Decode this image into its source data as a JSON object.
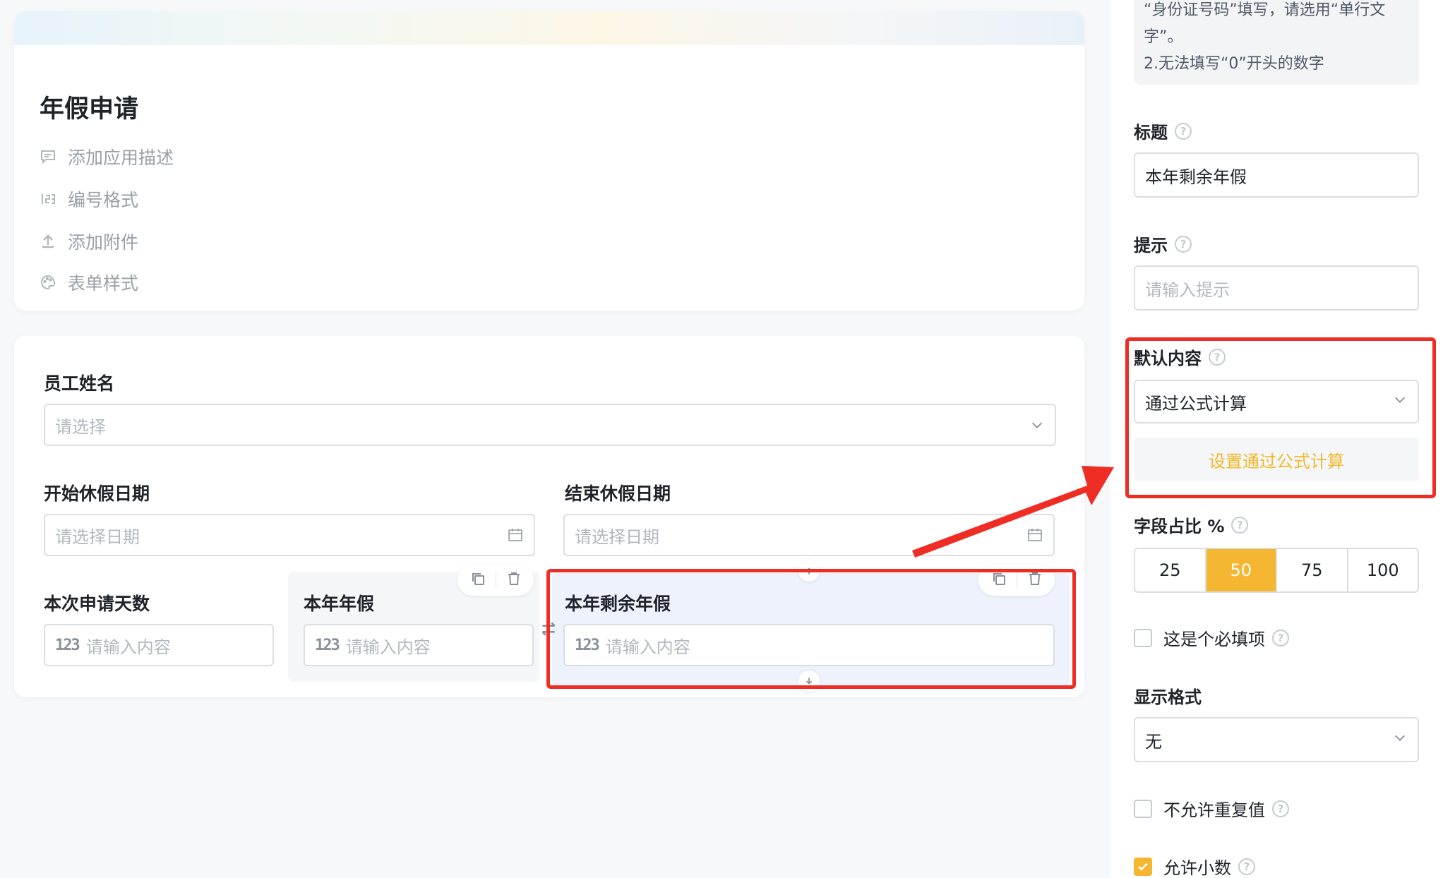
{
  "form": {
    "title": "年假申请",
    "options": [
      {
        "icon": "comment-icon",
        "label": "添加应用描述"
      },
      {
        "icon": "number-format-icon",
        "label": "编号格式"
      },
      {
        "icon": "upload-icon",
        "label": "添加附件"
      },
      {
        "icon": "palette-icon",
        "label": "表单样式"
      }
    ]
  },
  "fields": {
    "employee": {
      "label": "员工姓名",
      "placeholder": "请选择"
    },
    "start_date": {
      "label": "开始休假日期",
      "placeholder": "请选择日期"
    },
    "end_date": {
      "label": "结束休假日期",
      "placeholder": "请选择日期"
    },
    "days": {
      "label": "本次申请天数",
      "placeholder": "请输入内容"
    },
    "annual": {
      "label": "本年年假",
      "placeholder": "请输入内容"
    },
    "remaining": {
      "label": "本年剩余年假",
      "placeholder": "请输入内容"
    },
    "number_icon": "123"
  },
  "panel": {
    "note_lines": [
      "“身份证号码”填写，请选用“单行文",
      "字”。",
      "2.无法填写“0”开头的数字"
    ],
    "title_label": "标题",
    "title_value": "本年剩余年假",
    "hint_label": "提示",
    "hint_placeholder": "请输入提示",
    "default_label": "默认内容",
    "default_value": "通过公式计算",
    "formula_button": "设置通过公式计算",
    "ratio_label": "字段占比 %",
    "ratio_options": [
      "25",
      "50",
      "75",
      "100"
    ],
    "ratio_selected": "50",
    "required_label": "这是个必填项",
    "display_label": "显示格式",
    "display_value": "无",
    "no_duplicate_label": "不允许重复值",
    "allow_decimal_label": "允许小数",
    "help_glyph": "?"
  },
  "colors": {
    "accent": "#f5b731",
    "annotation": "#ee2d25",
    "selected_bg": "#edf2fc"
  }
}
